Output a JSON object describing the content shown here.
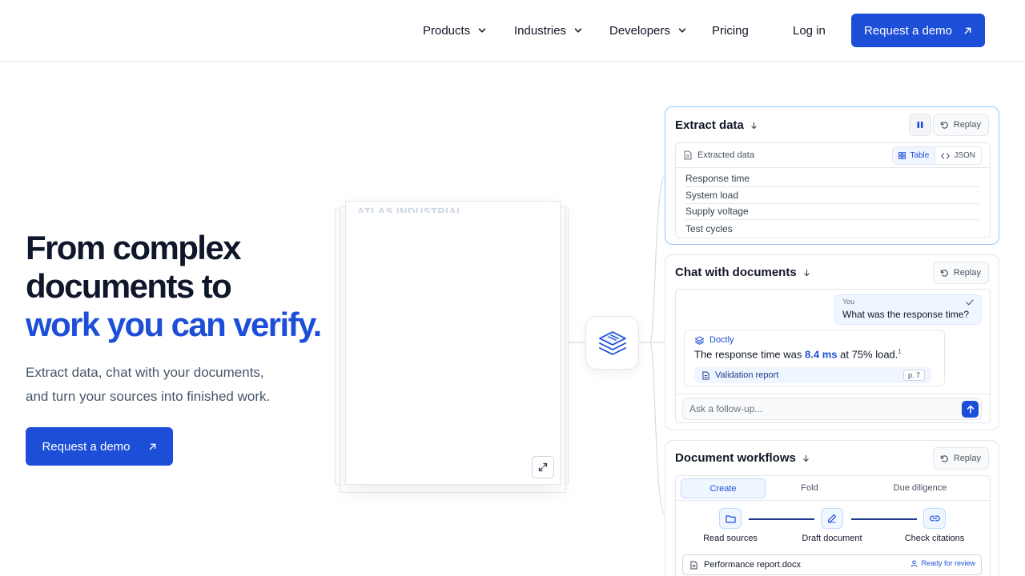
{
  "nav": {
    "items": [
      {
        "label": "Products",
        "has_dropdown": true
      },
      {
        "label": "Industries",
        "has_dropdown": true
      },
      {
        "label": "Developers",
        "has_dropdown": true
      },
      {
        "label": "Pricing",
        "has_dropdown": false
      }
    ],
    "login": "Log in",
    "cta": "Request a demo"
  },
  "hero": {
    "title_line1": "From complex",
    "title_line2": "documents to",
    "title_line3": "work you can verify.",
    "subtitle_line1": "Extract data, chat with your documents,",
    "subtitle_line2": "and turn your sources into finished work.",
    "cta": "Request a demo"
  },
  "document": {
    "heading": "ATLAS INDUSTRIAL"
  },
  "panels": {
    "extract": {
      "title": "Extract data",
      "replay": "Replay",
      "card_label": "Extracted data",
      "view_table": "Table",
      "view_json": "JSON",
      "rows": [
        "Response time",
        "System load",
        "Supply voltage",
        "Test cycles"
      ]
    },
    "chat": {
      "title": "Chat with documents",
      "replay": "Replay",
      "user_label": "You",
      "user_question": "What was the response time?",
      "bot_name": "Doctly",
      "answer_prefix": "The response time was ",
      "answer_value": "8.4 ms",
      "answer_suffix": " at 75% load.",
      "answer_footnote": "1",
      "citation_doc": "Validation report",
      "citation_page": "p. 7",
      "input_placeholder": "Ask a follow-up..."
    },
    "workflow": {
      "title": "Document workflows",
      "replay": "Replay",
      "tabs": [
        "Create",
        "Fold",
        "Due diligence"
      ],
      "steps": [
        "Read sources",
        "Draft document",
        "Check citations"
      ],
      "file_name": "Performance report.docx",
      "file_status": "Ready for review"
    }
  },
  "colors": {
    "brand": "#1d4ed8",
    "text": "#0f172a",
    "muted": "#475569",
    "border": "#e5e7eb",
    "accent_bg": "#eff6ff"
  }
}
